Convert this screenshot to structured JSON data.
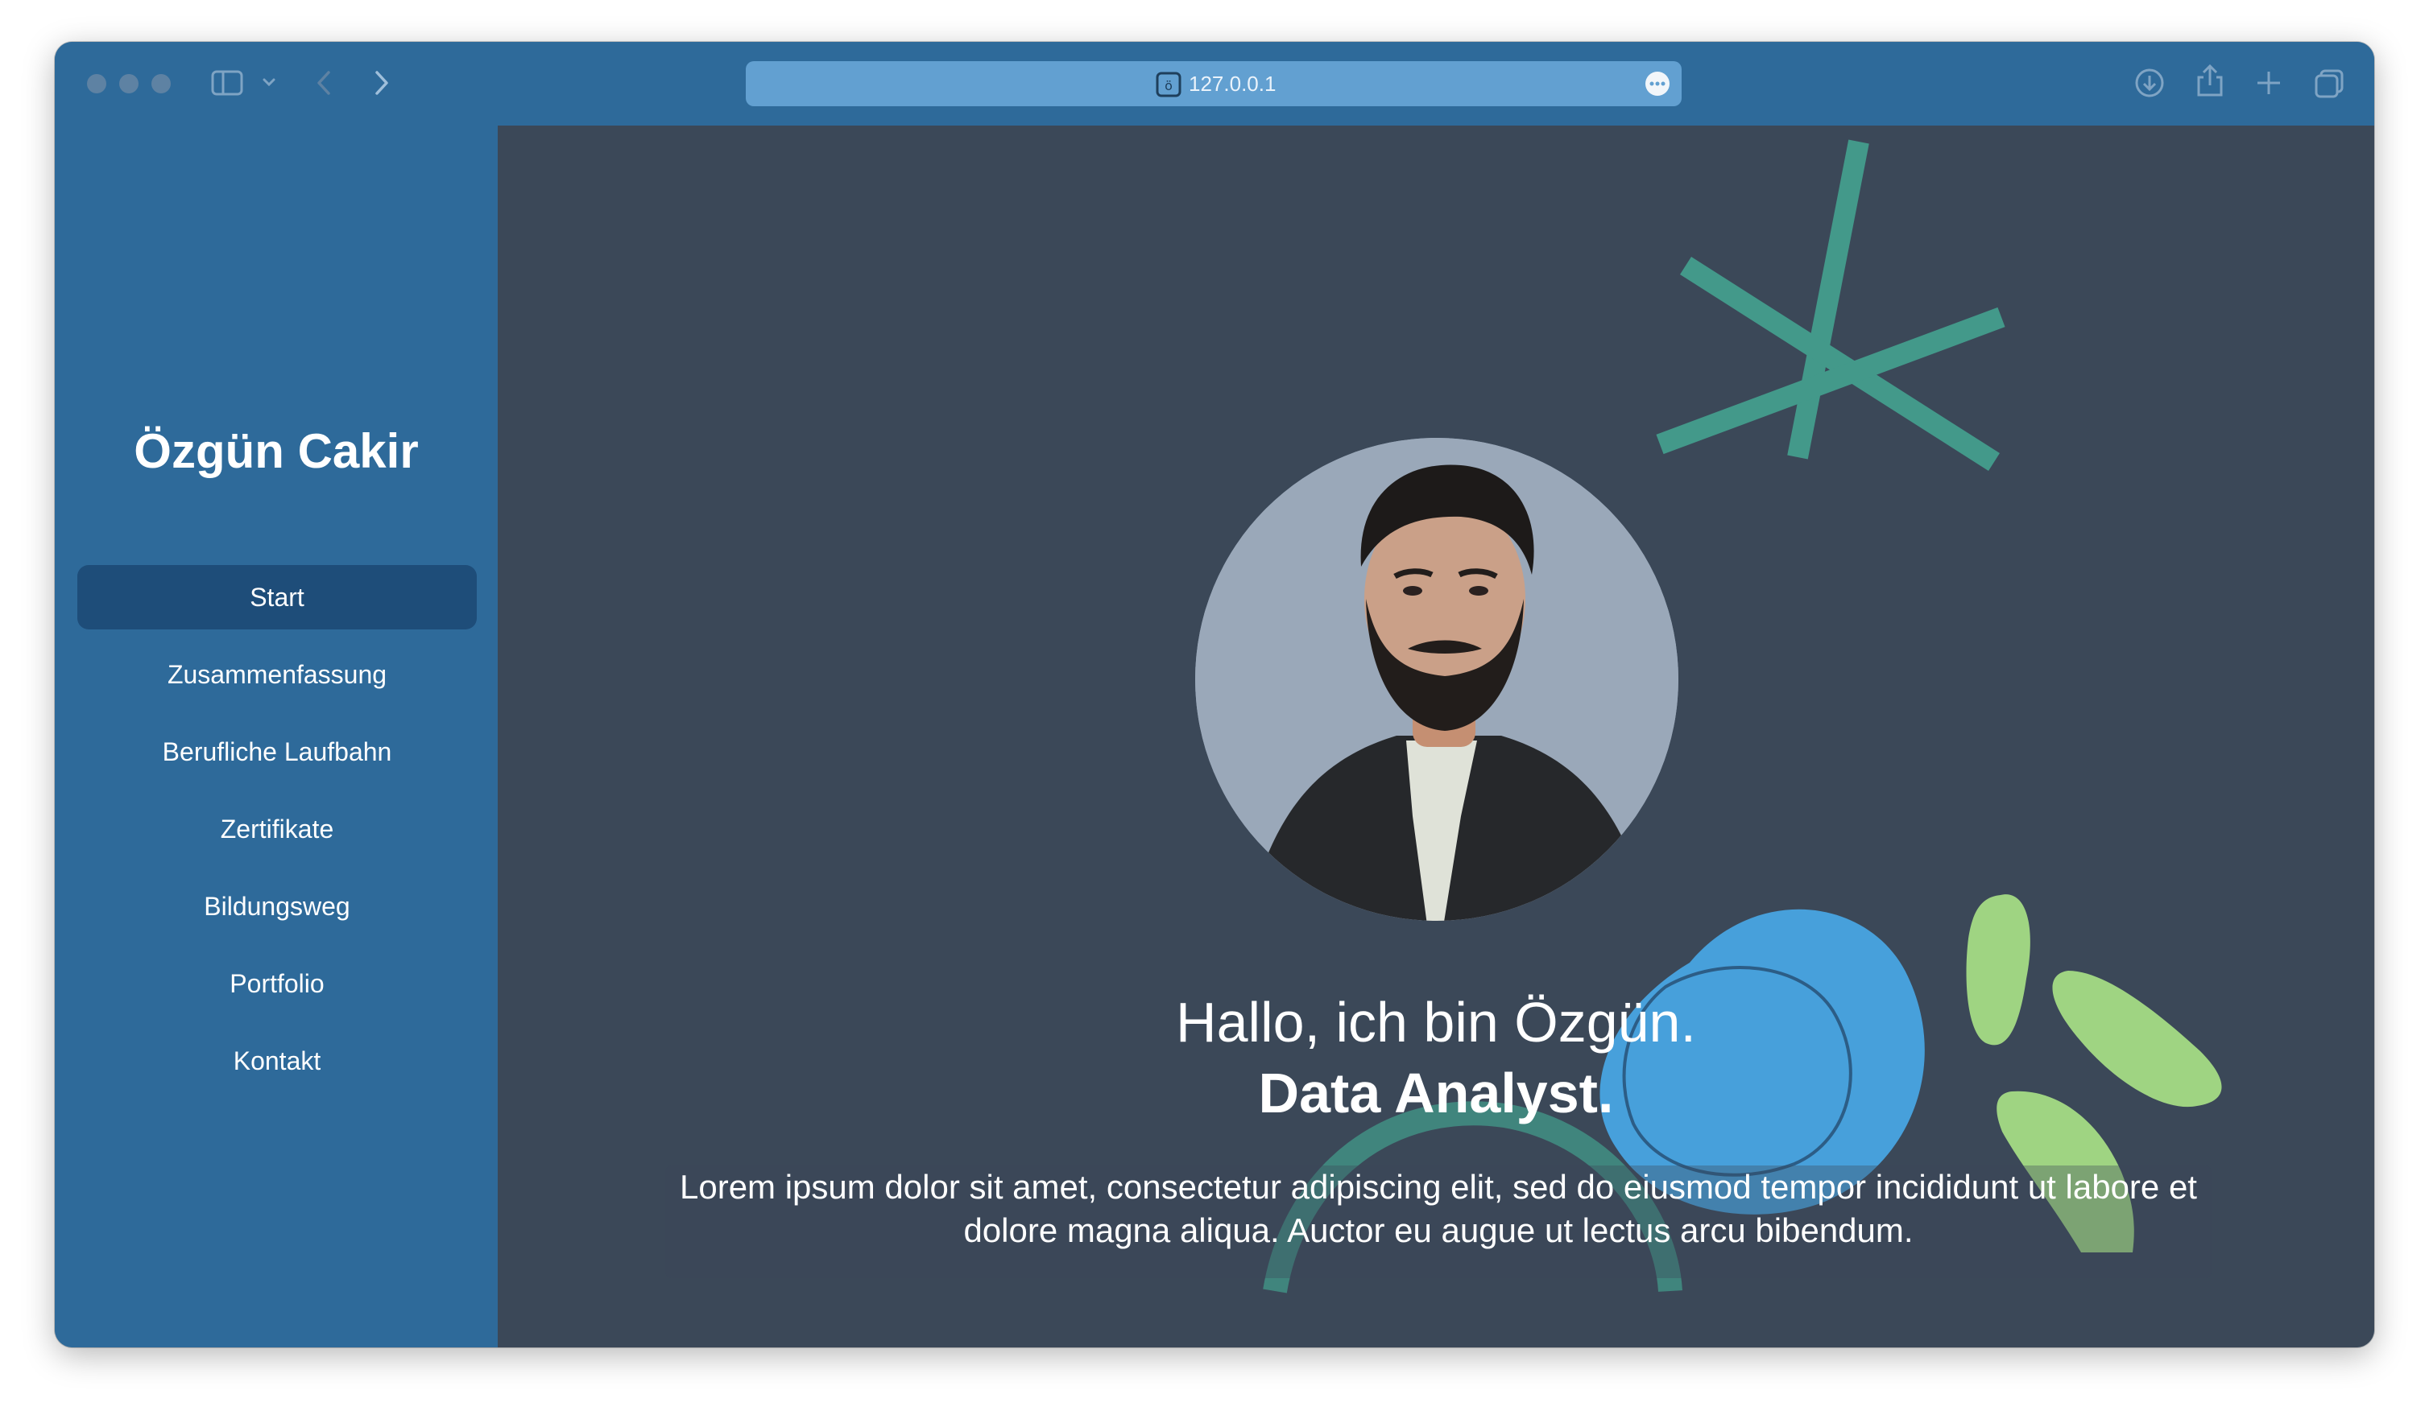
{
  "browser": {
    "url": "127.0.0.1",
    "icons": {
      "sidebar_toggle": "sidebar-icon",
      "chevron": "chevron-down-icon",
      "back": "back-arrow-icon",
      "forward": "forward-arrow-icon",
      "site": "site-icon",
      "more": "ellipsis-icon",
      "download": "download-icon",
      "share": "share-icon",
      "new_tab": "plus-icon",
      "tabs": "tab-overview-icon"
    }
  },
  "sidebar": {
    "title": "Özgün Cakir",
    "items": [
      {
        "label": "Start",
        "active": true
      },
      {
        "label": "Zusammenfassung",
        "active": false
      },
      {
        "label": "Berufliche Laufbahn",
        "active": false
      },
      {
        "label": "Zertifikate",
        "active": false
      },
      {
        "label": "Bildungsweg",
        "active": false
      },
      {
        "label": "Portfolio",
        "active": false
      },
      {
        "label": "Kontakt",
        "active": false
      }
    ]
  },
  "main": {
    "headline_line1": "Hallo, ich bin Özgün.",
    "headline_line2": "Data Analyst.",
    "lead": "Lorem ipsum dolor sit amet, consectetur adipiscing elit, sed do eiusmod tempor incididunt ut labore et dolore magna aliqua. Auctor eu augue ut lectus arcu bibendum."
  },
  "colors": {
    "toolbar_blue": "#2e6a9a",
    "active_nav": "#1e4d79",
    "main_bg": "#3b4858",
    "accent_teal": "#43998a",
    "accent_blue": "#47a0db",
    "accent_green": "#9fd482"
  }
}
